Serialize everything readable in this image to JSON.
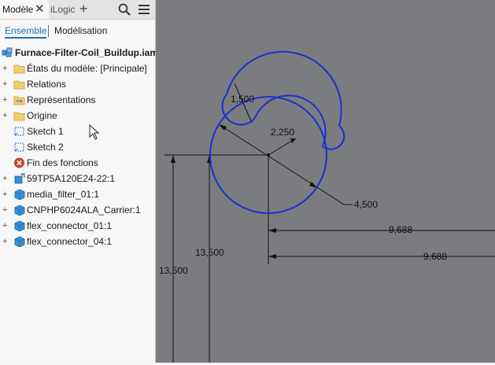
{
  "browser": {
    "tabs": {
      "active": "Modèle",
      "inactive": "iLogic"
    },
    "subtabs": {
      "active": "Ensemble",
      "inactive": "Modélisation"
    },
    "root_label": "Furnace-Filter-Coil_Buildup.iam",
    "tree": [
      {
        "label": "États du modèle: [Principale]",
        "icon": "folder-icon"
      },
      {
        "label": "Relations",
        "icon": "folder-icon"
      },
      {
        "label": "Représentations",
        "icon": "representations-folder-icon"
      },
      {
        "label": "Origine",
        "icon": "folder-icon"
      },
      {
        "label": "Sketch 1",
        "icon": "sketch-icon"
      },
      {
        "label": "Sketch 2",
        "icon": "sketch-icon"
      },
      {
        "label": "Fin des fonctions",
        "icon": "end-of-features-icon"
      },
      {
        "label": "59TP5A120E24-22:1",
        "icon": "subassembly-icon"
      },
      {
        "label": "media_filter_01:1",
        "icon": "part-icon"
      },
      {
        "label": "CNPHP6024ALA_Carrier:1",
        "icon": "part-icon"
      },
      {
        "label": "flex_connector_01:1",
        "icon": "part-icon"
      },
      {
        "label": "flex_connector_04:1",
        "icon": "part-icon"
      }
    ]
  },
  "canvas": {
    "dimensions": {
      "small_radius": "1,500",
      "mid_radius": "2,250",
      "large_radius": "4,500",
      "horiz_top": "9,688",
      "horiz_bottom": "9,688",
      "vert_inner": "13,500",
      "vert_outer": "13,500"
    }
  },
  "colors": {
    "canvas_bg": "#7b7c80",
    "sketch_curve": "#1a2fd0",
    "accent_blue": "#1b6fbf",
    "panel_bg": "#f7f7f7"
  }
}
